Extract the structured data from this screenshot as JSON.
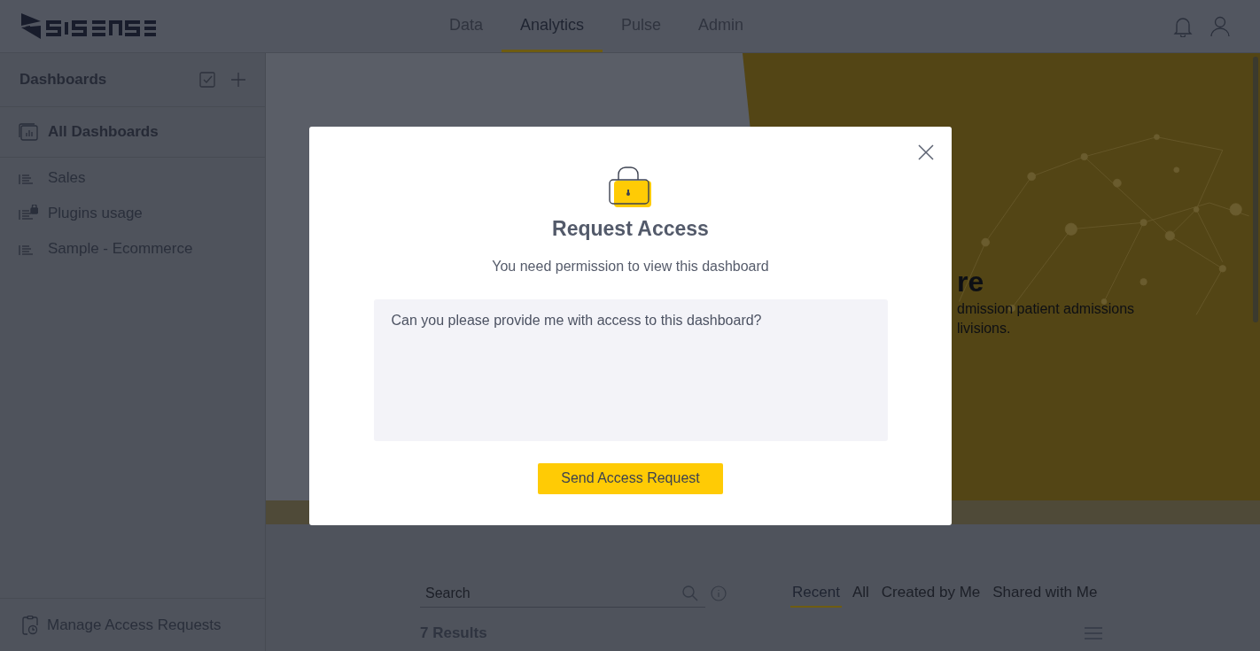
{
  "topbar": {
    "nav": [
      {
        "label": "Data",
        "selected": false
      },
      {
        "label": "Analytics",
        "selected": true
      },
      {
        "label": "Pulse",
        "selected": false
      },
      {
        "label": "Admin",
        "selected": false
      }
    ]
  },
  "sidebar": {
    "title": "Dashboards",
    "items": [
      {
        "label": "All Dashboards",
        "kind": "all",
        "locked": false
      },
      {
        "label": "Sales",
        "kind": "dashboard",
        "locked": false
      },
      {
        "label": "Plugins usage",
        "kind": "dashboard",
        "locked": true
      },
      {
        "label": "Sample - Ecommerce",
        "kind": "dashboard",
        "locked": false
      }
    ],
    "footer": "Manage Access Requests"
  },
  "hero": {
    "title": "re",
    "lines": [
      "dmission patient admissions",
      "livisions."
    ]
  },
  "browse": {
    "search": {
      "placeholder": "Search"
    },
    "tabs": [
      {
        "label": "Recent",
        "selected": true
      },
      {
        "label": "All",
        "selected": false
      },
      {
        "label": "Created by Me",
        "selected": false
      },
      {
        "label": "Shared with Me",
        "selected": false
      }
    ],
    "results": "7 Results"
  },
  "dialog": {
    "title": "Request Access",
    "subtitle": "You need permission to view this dashboard",
    "message": "Can you please provide me with access to this dashboard?",
    "button": "Send Access Request"
  }
}
